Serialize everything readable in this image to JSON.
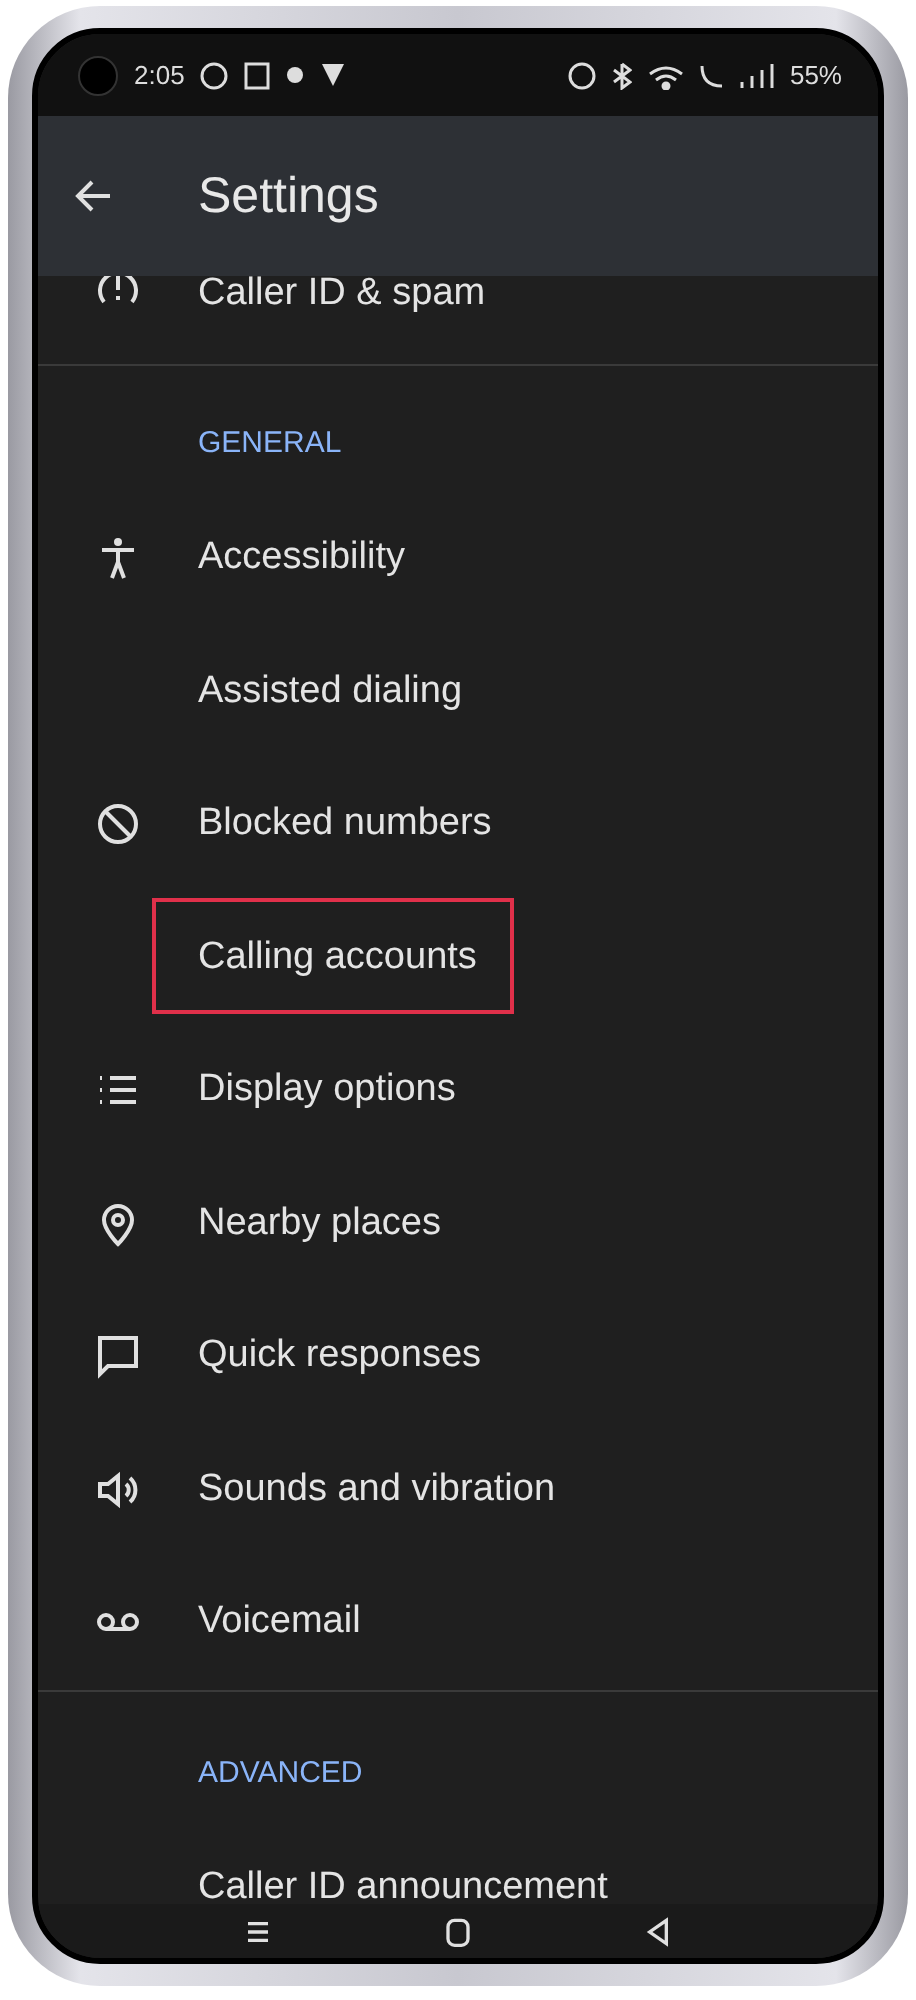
{
  "status_bar": {
    "time": "2:05",
    "battery": "55%"
  },
  "app_bar": {
    "title": "Settings"
  },
  "items": [
    {
      "kind": "row",
      "label": "Caller ID & spam",
      "highlighted": false
    },
    {
      "kind": "header",
      "label": "GENERAL"
    },
    {
      "kind": "row",
      "label": "Accessibility",
      "highlighted": false
    },
    {
      "kind": "row",
      "label": "Assisted dialing",
      "highlighted": false
    },
    {
      "kind": "row",
      "label": "Blocked numbers",
      "highlighted": false
    },
    {
      "kind": "row",
      "label": "Calling accounts",
      "highlighted": true
    },
    {
      "kind": "row",
      "label": "Display options",
      "highlighted": false
    },
    {
      "kind": "row",
      "label": "Nearby places",
      "highlighted": false
    },
    {
      "kind": "row",
      "label": "Quick responses",
      "highlighted": false
    },
    {
      "kind": "row",
      "label": "Sounds and vibration",
      "highlighted": false
    },
    {
      "kind": "row",
      "label": "Voicemail",
      "highlighted": false
    },
    {
      "kind": "header",
      "label": "ADVANCED"
    },
    {
      "kind": "row",
      "label": "Caller ID announcement",
      "highlighted": false
    }
  ]
}
